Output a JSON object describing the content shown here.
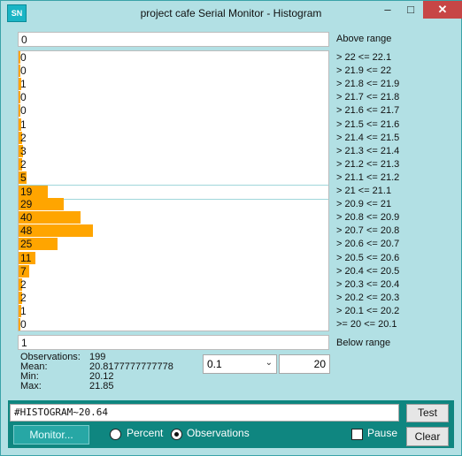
{
  "window": {
    "title": "project cafe Serial Monitor - Histogram",
    "icon_text": "SN",
    "controls": {
      "minimize": "–",
      "maximize": "□",
      "close": "✕"
    }
  },
  "above_range": {
    "value": "0",
    "label": "Above range"
  },
  "below_range": {
    "value": "1",
    "label": "Below range"
  },
  "chart_data": {
    "type": "bar",
    "orientation": "horizontal",
    "categories": [
      "> 22 <= 22.1",
      "> 21.9 <= 22",
      "> 21.8 <= 21.9",
      "> 21.7 <= 21.8",
      "> 21.6 <= 21.7",
      "> 21.5 <= 21.6",
      "> 21.4 <= 21.5",
      "> 21.3 <= 21.4",
      "> 21.2 <= 21.3",
      "> 21.1 <= 21.2",
      "> 21 <= 21.1",
      "> 20.9 <= 21",
      "> 20.8 <= 20.9",
      "> 20.7 <= 20.8",
      "> 20.6 <= 20.7",
      "> 20.5 <= 20.6",
      "> 20.4 <= 20.5",
      "> 20.3 <= 20.4",
      "> 20.2 <= 20.3",
      "> 20.1 <= 20.2",
      ">= 20 <= 20.1"
    ],
    "values": [
      0,
      0,
      1,
      0,
      0,
      1,
      2,
      3,
      2,
      5,
      19,
      29,
      40,
      48,
      25,
      11,
      7,
      2,
      2,
      1,
      0
    ],
    "highlight_index": 10,
    "bar_color": "#ffa500"
  },
  "stats": {
    "observations_label": "Observations:",
    "observations": "199",
    "mean_label": "Mean:",
    "mean": "20.8177777777778",
    "min_label": "Min:",
    "min": "20.12",
    "max_label": "Max:",
    "max": "21.85"
  },
  "bin_select": {
    "value": "0.1",
    "arrow": "⌄"
  },
  "bin_count_input": {
    "value": "20"
  },
  "command": {
    "value": "#HISTOGRAM~20.64"
  },
  "buttons": {
    "test": "Test",
    "clear": "Clear",
    "monitor": "Monitor..."
  },
  "mode": {
    "percent": "Percent",
    "observations": "Observations",
    "selected": "observations"
  },
  "pause": {
    "label": "Pause",
    "checked": false
  }
}
